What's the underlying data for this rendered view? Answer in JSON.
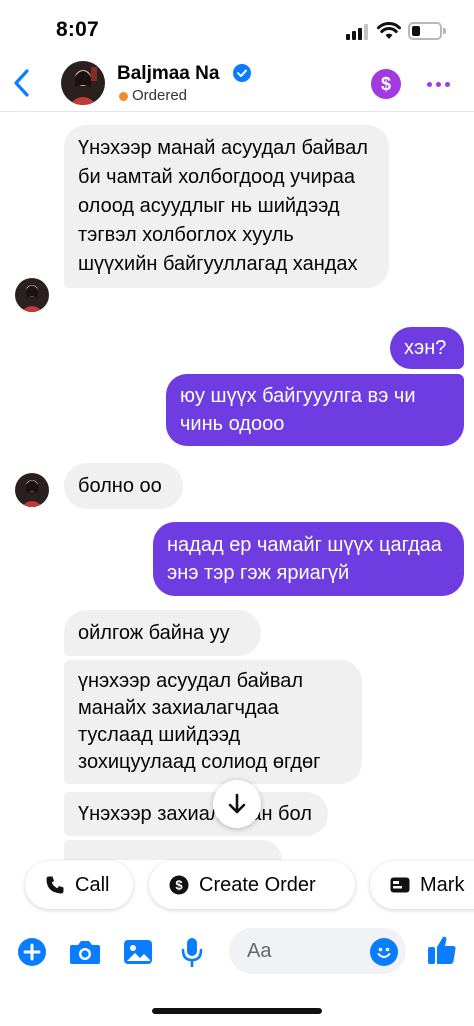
{
  "status_bar": {
    "time": "8:07"
  },
  "header": {
    "contact_name": "Baljmaa Na",
    "status": "Ordered",
    "pay_icon_label": "$"
  },
  "messages": [
    {
      "side": "in",
      "text": "Үнэхээр манай асуудал байвал би чамтай холбогдоод учираа олоод асуудлыг нь шийдээд тэгвэл холбоглох хууль шүүхийн байгууллагад хандах"
    },
    {
      "side": "out",
      "text": "хэн?"
    },
    {
      "side": "out",
      "text": "юу шүүх байгууулга вэ чи чинь одооо"
    },
    {
      "side": "in",
      "text": "болно оо"
    },
    {
      "side": "out",
      "text": "надад ер чамайг шүүх цагдаа энэ тэр гэж яриагүй"
    },
    {
      "side": "in",
      "text": "ойлгож байна уу"
    },
    {
      "side": "in",
      "text": "үнэхээр асуудал байвал манайх захиалагчдаа туслаад шийдээд зохицуулаад солиод өгдөг"
    },
    {
      "side": "in",
      "text": "Үнэхээр захиалагчан бол"
    }
  ],
  "quick_actions": {
    "call": "Call",
    "create_order": "Create Order",
    "mark": "Mark"
  },
  "composer": {
    "placeholder": "Aa"
  },
  "colors": {
    "accent": "#6e3ce0",
    "messenger_blue": "#0a7cff",
    "pay_purple": "#a33ae0",
    "incoming_bubble": "#f0f0f0",
    "status_orange": "#f28c28"
  },
  "icons": [
    "back-icon",
    "verified-icon",
    "dollar-icon",
    "more-icon",
    "scroll-down-icon",
    "phone-icon",
    "dollar-circle-icon",
    "card-icon",
    "plus-icon",
    "camera-icon",
    "image-icon",
    "mic-icon",
    "emoji-icon",
    "thumbs-up-icon"
  ]
}
